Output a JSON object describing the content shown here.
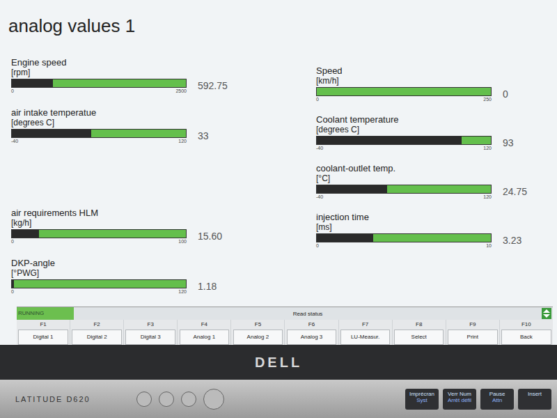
{
  "window": {
    "title": "analog values 1"
  },
  "gauges_left": [
    {
      "label": "Engine speed",
      "unit": "[rpm]",
      "min": "0",
      "max": "2500",
      "value": "592.75",
      "level": 0.237
    },
    {
      "label": "air intake temperatue",
      "unit": "[degrees C]",
      "min": "-40",
      "max": "120",
      "value": "33",
      "level": 0.456
    },
    {
      "label": "air requirements HLM",
      "unit": "[kg/h]",
      "min": "0",
      "max": "100",
      "value": "15.60",
      "level": 0.156
    },
    {
      "label": "DKP-angle",
      "unit": "[°PWG]",
      "min": "0",
      "max": "120",
      "value": "1.18",
      "level": 0.01
    }
  ],
  "gauges_right": [
    {
      "label": "Speed",
      "unit": "[km/h]",
      "min": "0",
      "max": "250",
      "value": "0",
      "level": 0
    },
    {
      "label": "Coolant temperature",
      "unit": "[degrees C]",
      "min": "-40",
      "max": "120",
      "value": "93",
      "level": 0.83
    },
    {
      "label": "coolant-outlet temp.",
      "unit": "[°C]",
      "min": "-40",
      "max": "120",
      "value": "24.75",
      "level": 0.405
    },
    {
      "label": "injection time",
      "unit": "[ms]",
      "min": "0",
      "max": "10",
      "value": "3.23",
      "level": 0.323
    }
  ],
  "status_bar": {
    "state": "RUNNING",
    "message": "Read status"
  },
  "function_keys": [
    {
      "key": "F1",
      "label": "Digital 1"
    },
    {
      "key": "F2",
      "label": "Digital 2"
    },
    {
      "key": "F3",
      "label": "Digital 3"
    },
    {
      "key": "F4",
      "label": "Analog 1"
    },
    {
      "key": "F5",
      "label": "Analog 2"
    },
    {
      "key": "F6",
      "label": "Analog 3"
    },
    {
      "key": "F7",
      "label": "LU-Measur."
    },
    {
      "key": "F8",
      "label": "Select"
    },
    {
      "key": "F9",
      "label": "Print"
    },
    {
      "key": "F10",
      "label": "Back"
    }
  ],
  "laptop": {
    "brand": "DELL",
    "model": "LATITUDE D620",
    "keys": [
      {
        "top": "Imprécran",
        "bottom": "Syst"
      },
      {
        "top": "Verr Num",
        "bottom": "Arrêt défil"
      },
      {
        "top": "Pause",
        "bottom": "Attn"
      },
      {
        "top": "Insert",
        "bottom": ""
      }
    ]
  }
}
